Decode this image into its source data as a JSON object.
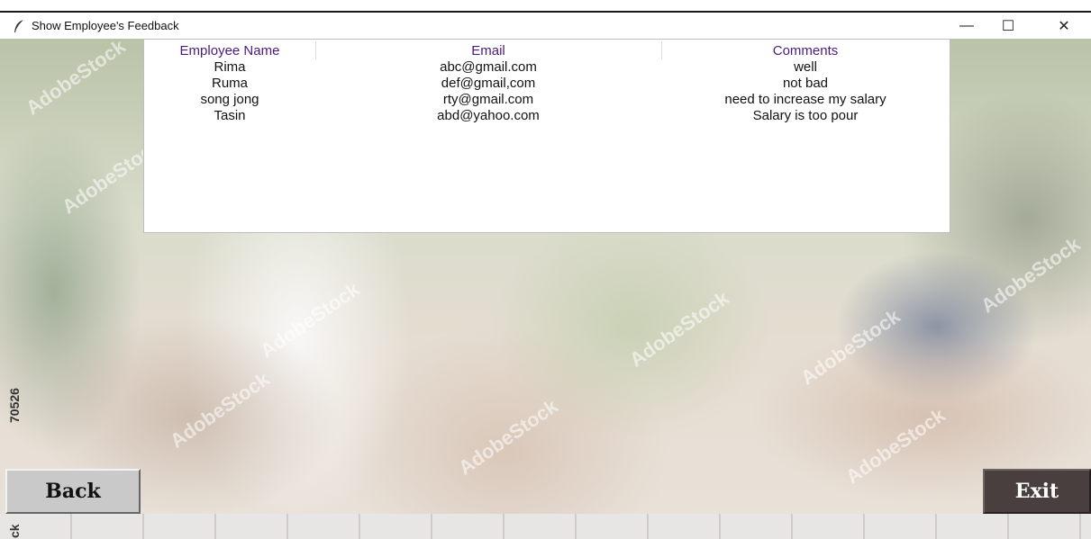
{
  "window": {
    "title": "Show Employee's Feedback",
    "controls": {
      "minimize": "—",
      "maximize": "☐",
      "close": "✕"
    }
  },
  "table": {
    "columns": [
      "Employee Name",
      "Email",
      "Comments"
    ],
    "rows": [
      {
        "name": "Rima",
        "email": "abc@gmail.com",
        "comment": "well"
      },
      {
        "name": "Ruma",
        "email": "def@gmail,com",
        "comment": "not bad"
      },
      {
        "name": "song jong",
        "email": "rty@gmail.com",
        "comment": "need to increase my salary"
      },
      {
        "name": "Tasin",
        "email": "abd@yahoo.com",
        "comment": "Salary is too pour"
      }
    ]
  },
  "buttons": {
    "back": "Back",
    "exit": "Exit"
  },
  "background": {
    "watermark": "AdobeStock",
    "side_id_1": "70526",
    "side_id_2": "ck"
  },
  "colors": {
    "header_text": "#4b1a7d",
    "exit_bg": "#4a3f3f",
    "back_bg": "#c9c9c9"
  }
}
